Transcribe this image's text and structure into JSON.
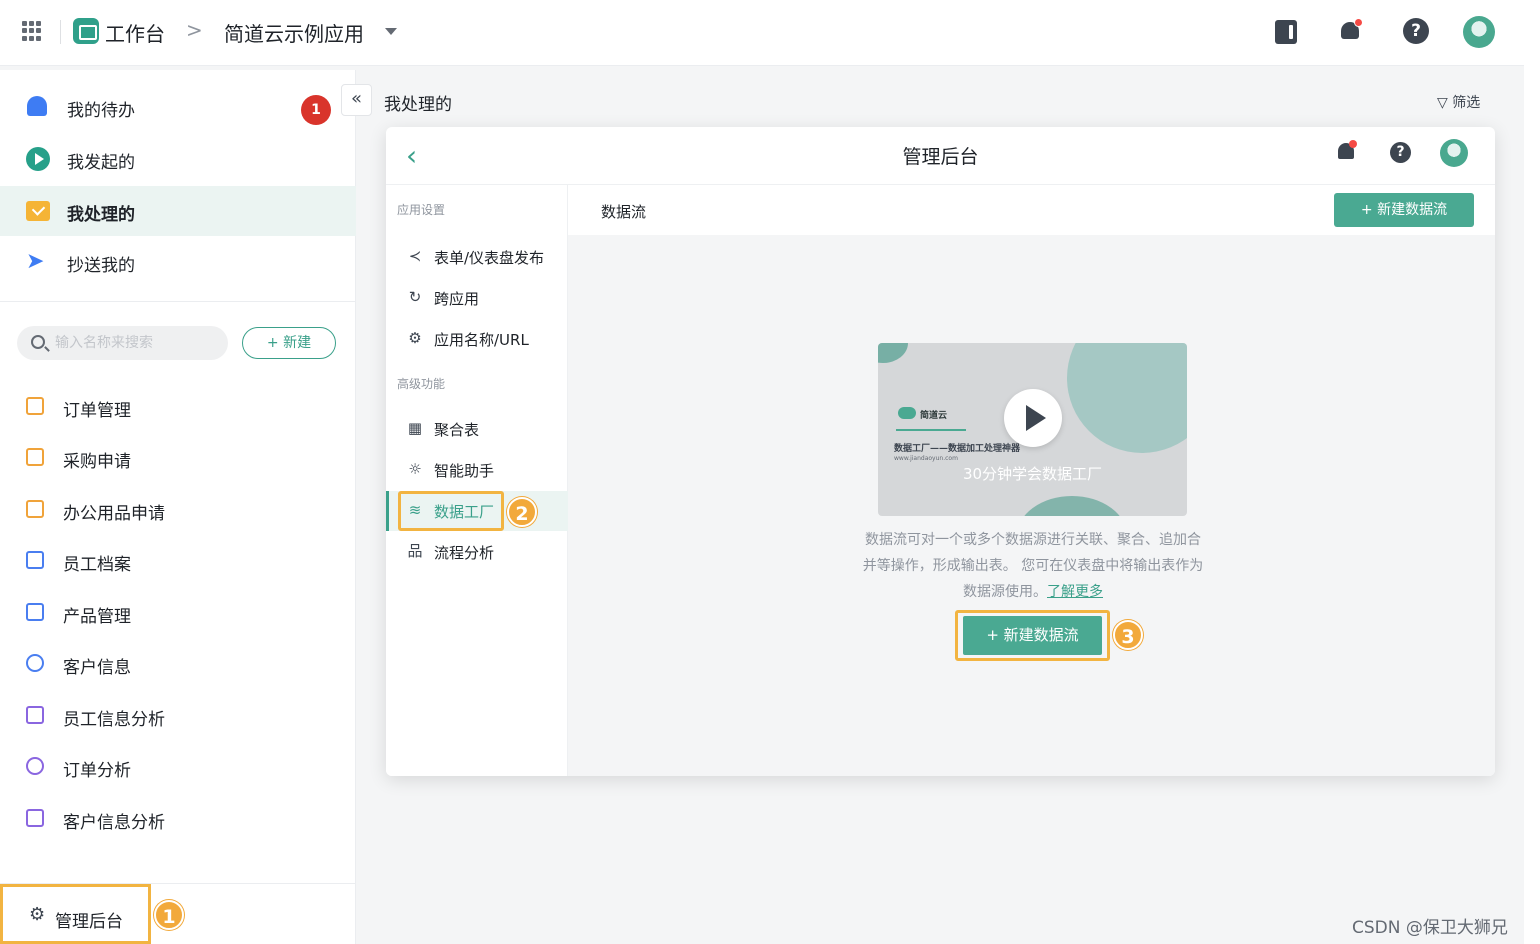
{
  "topbar": {
    "workbench": "工作台",
    "crumb_sep": ">",
    "app_name": "简道云示例应用",
    "icons": [
      "grid-icon",
      "book-icon",
      "bell-icon",
      "help-icon",
      "avatar"
    ]
  },
  "sidebar": {
    "nav": [
      {
        "label": "我的待办",
        "icon": "bell-icon"
      },
      {
        "label": "我发起的",
        "icon": "play-icon"
      },
      {
        "label": "我处理的",
        "icon": "check-icon"
      },
      {
        "label": "抄送我的",
        "icon": "send-icon"
      }
    ],
    "badge": "1",
    "search_placeholder": "输入名称来搜索",
    "new_label": "+ 新建",
    "forms": [
      "订单管理",
      "采购申请",
      "办公用品申请",
      "员工档案",
      "产品管理",
      "客户信息",
      "员工信息分析",
      "订单分析",
      "客户信息分析"
    ],
    "admin_label": "管理后台"
  },
  "steps": [
    "1",
    "2",
    "3"
  ],
  "main": {
    "collapse": "«",
    "title": "我处理的",
    "filter": "筛选"
  },
  "modal": {
    "title": "管理后台",
    "groups": {
      "app_settings": "应用设置",
      "advanced": "高级功能"
    },
    "items": [
      {
        "label": "表单/仪表盘发布",
        "icon": "share-icon"
      },
      {
        "label": "跨应用",
        "icon": "cross-app-icon"
      },
      {
        "label": "应用名称/URL",
        "icon": "gear-icon"
      },
      {
        "label": "聚合表",
        "icon": "table-icon"
      },
      {
        "label": "智能助手",
        "icon": "bulb-icon"
      },
      {
        "label": "数据工厂",
        "icon": "database-icon"
      },
      {
        "label": "流程分析",
        "icon": "flow-icon"
      }
    ],
    "content_title": "数据流",
    "new_flow": "+ 新建数据流",
    "video": {
      "brand": "简道云",
      "subtitle": "数据工厂——数据加工处理神器",
      "url": "www.jiandaoyun.com",
      "title": "30分钟学会数据工厂"
    },
    "desc_line1": "数据流可对一个或多个数据源进行关联、聚合、追加合",
    "desc_line2": "并等操作，形成输出表。 您可在仪表盘中将输出表作为",
    "desc_line3": "数据源使用。",
    "learn_more": "了解更多",
    "create_btn": "+ 新建数据流"
  },
  "watermark": "CSDN @保卫大狮兄",
  "colors": {
    "brand": "#4aa992",
    "highlight": "#f2b441",
    "badge": "#d9342b"
  }
}
